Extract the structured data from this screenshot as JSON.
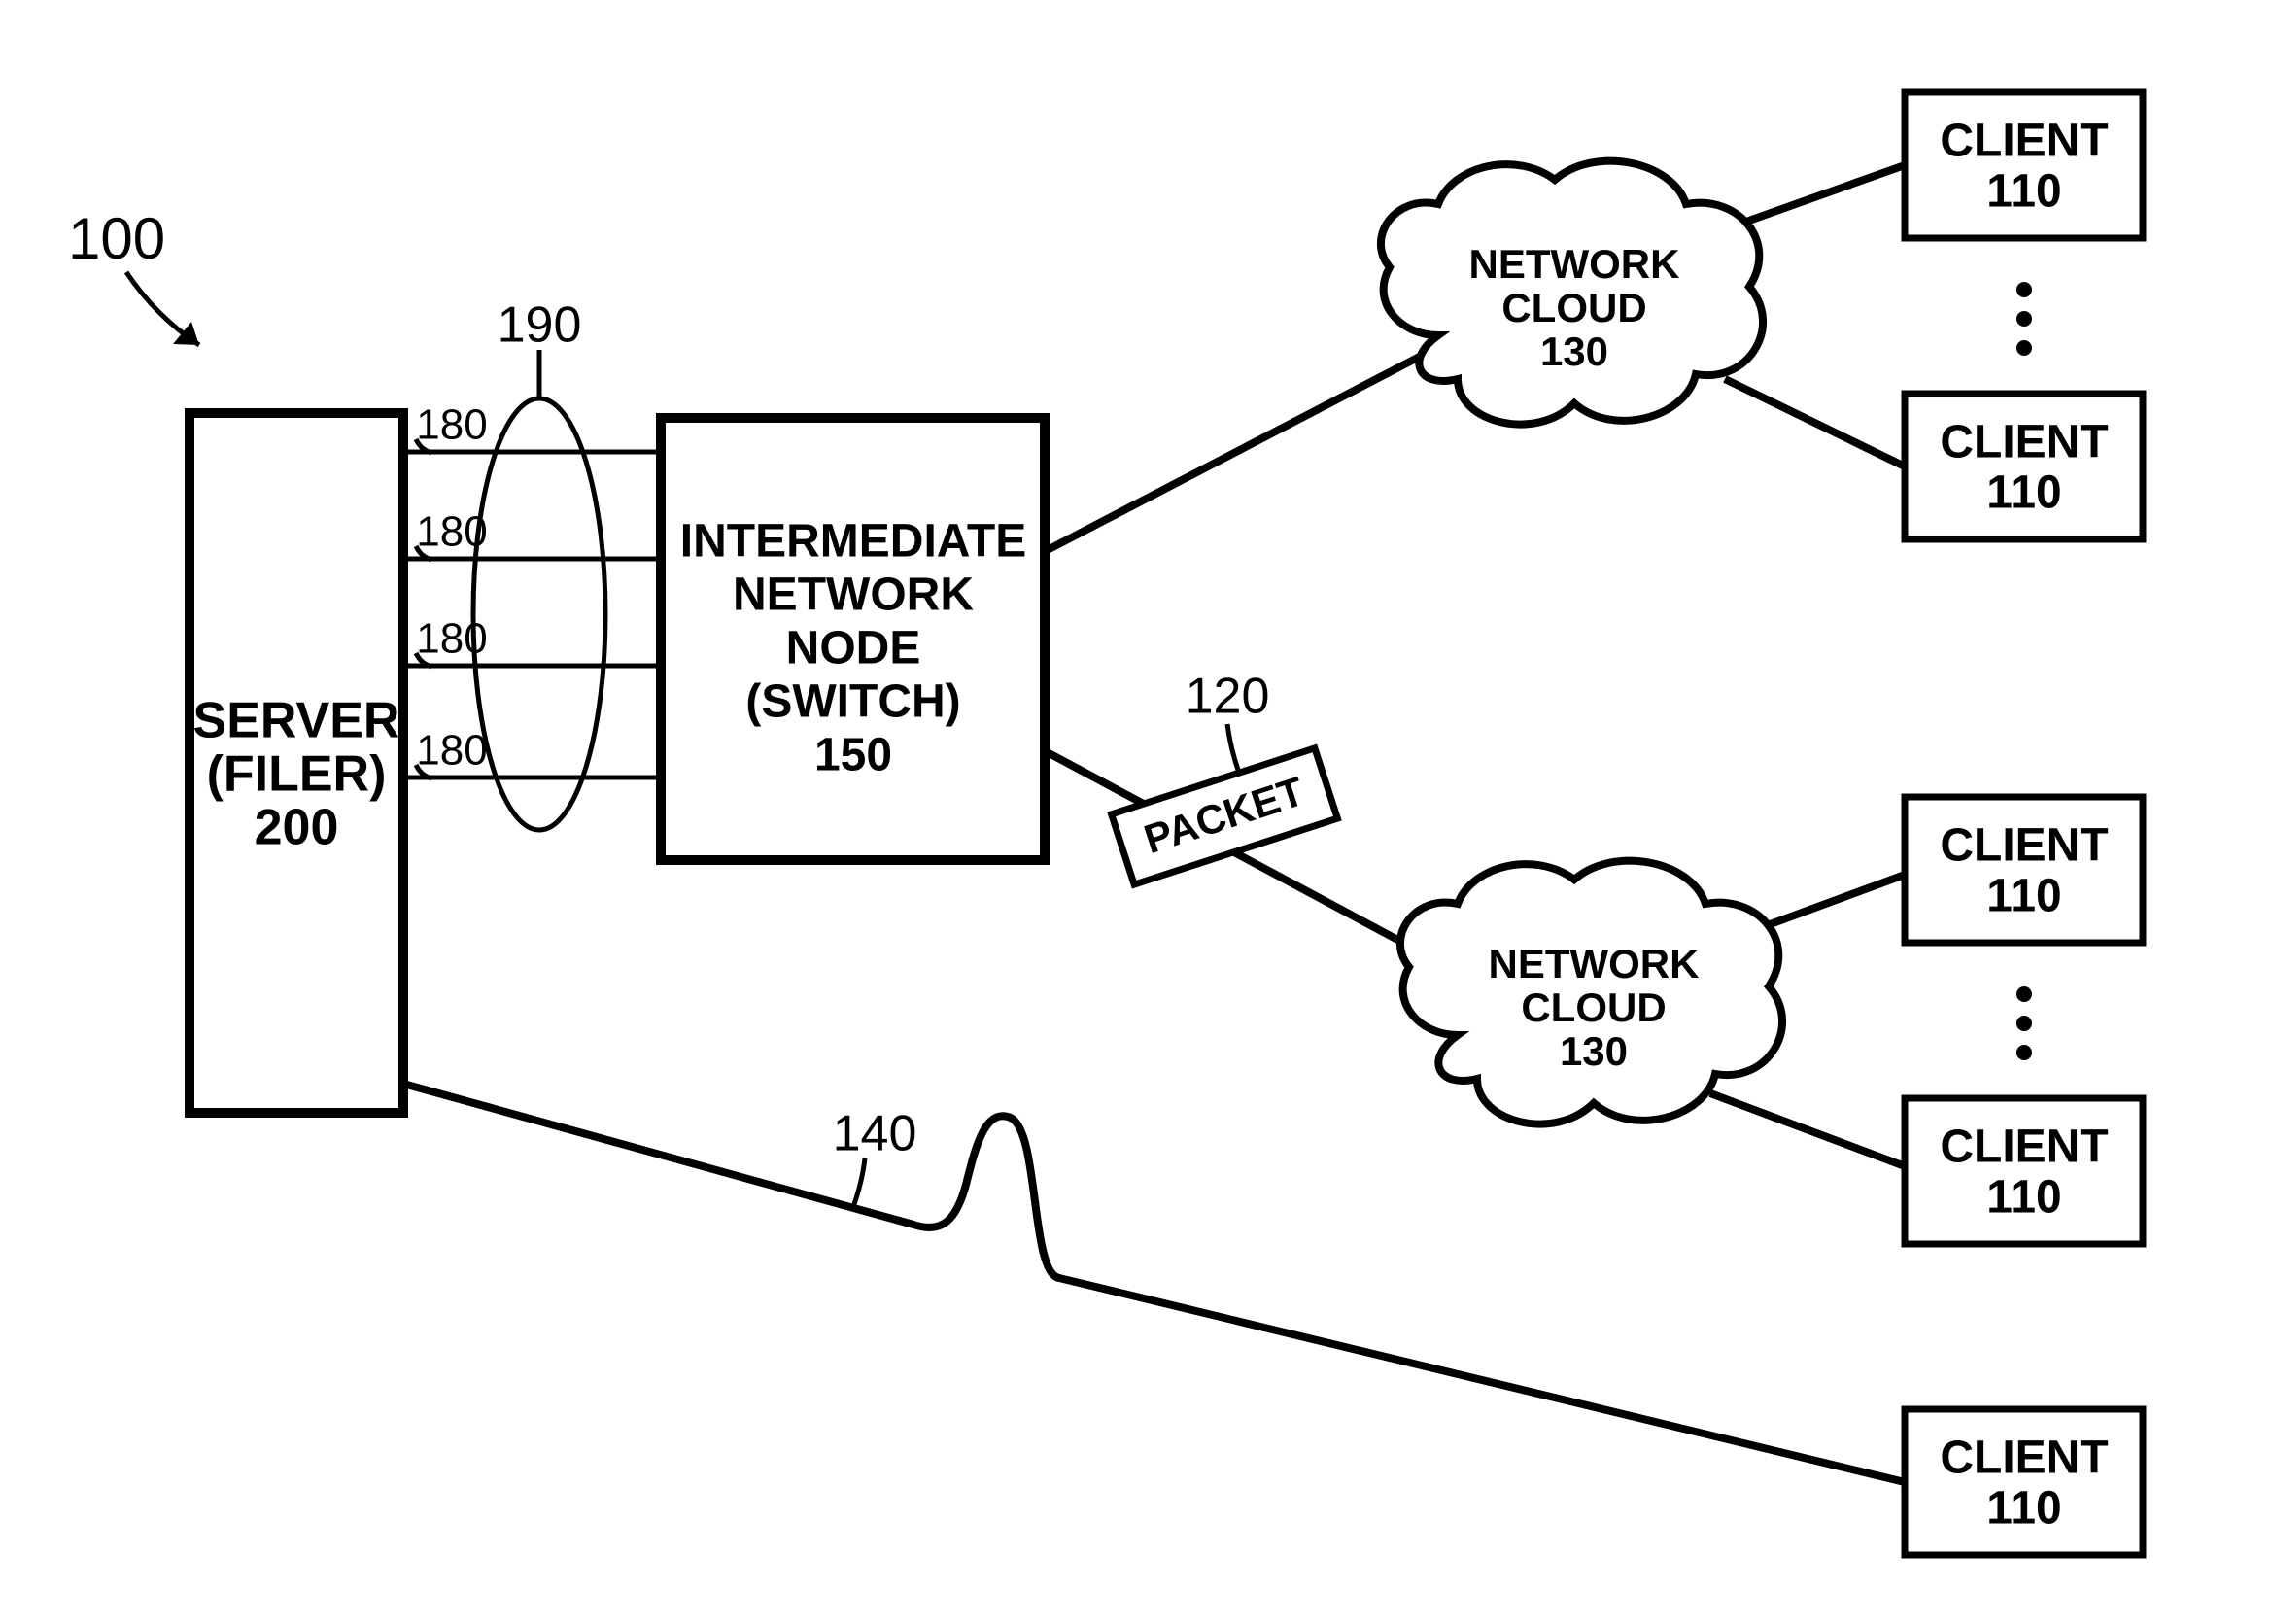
{
  "figure_ref": "100",
  "server": {
    "line1": "SERVER",
    "line2": "(FILER)",
    "ref": "200"
  },
  "switch": {
    "line1": "INTERMEDIATE",
    "line2": "NETWORK",
    "line3": "NODE",
    "line4": "(SWITCH)",
    "ref": "150"
  },
  "links_ref": "180",
  "link_group_ref": "190",
  "packet": {
    "label": "PACKET",
    "ref": "120"
  },
  "cloud": {
    "line1": "NETWORK",
    "line2": "CLOUD",
    "ref": "130"
  },
  "client": {
    "label": "CLIENT",
    "ref": "110"
  },
  "direct_link_ref": "140"
}
